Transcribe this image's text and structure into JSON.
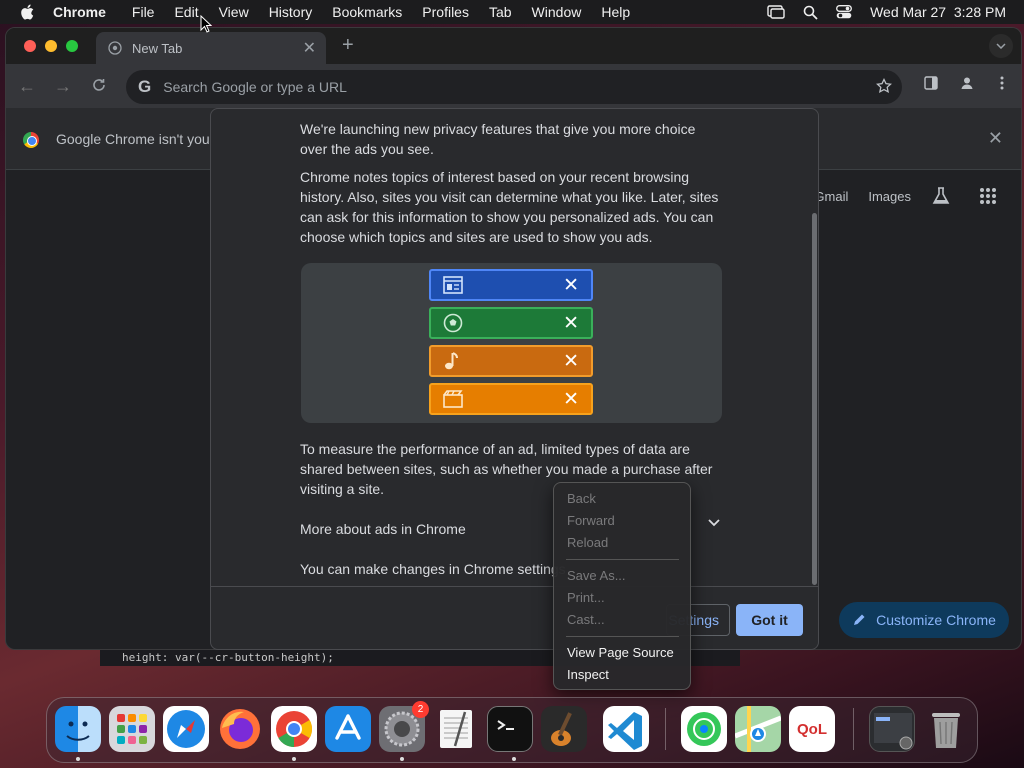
{
  "menubar": {
    "app_name": "Chrome",
    "items": [
      "File",
      "Edit",
      "View",
      "History",
      "Bookmarks",
      "Profiles",
      "Tab",
      "Window",
      "Help"
    ],
    "datetime": "Wed Mar 27  3:28 PM"
  },
  "browser": {
    "tab_title": "New Tab",
    "omnibox_placeholder": "Search Google or type a URL",
    "infobar_text": "Google Chrome isn't you",
    "ntp_links": [
      "Gmail",
      "Images"
    ],
    "customize_label": "Customize Chrome"
  },
  "dialog": {
    "para1": "We're launching new privacy features that give you more choice over the ads you see.",
    "para2": "Chrome notes topics of interest based on your recent browsing history. Also, sites you visit can determine what you like. Later, sites can ask for this information to show you personalized ads. You can choose which topics and sites are used to show you ads.",
    "para3": "To measure the performance of an ad, limited types of data are shared between sites, such as whether you made a purchase after visiting a site.",
    "expand_label": "More about ads in Chrome",
    "settings_text": "You can make changes in Chrome settings",
    "settings_button_label": "Settings",
    "gotit_label": "Got it",
    "topics": [
      {
        "icon": "newspaper-icon",
        "color": "#4f86f7",
        "bg": "#1e4fb0"
      },
      {
        "icon": "soccer-ball-icon",
        "color": "#3ab05a",
        "bg": "#1d7a38"
      },
      {
        "icon": "music-note-icon",
        "color": "#f29c2b",
        "bg": "#c96a10"
      },
      {
        "icon": "clapperboard-icon",
        "color": "#f7a21c",
        "bg": "#e67e00"
      }
    ]
  },
  "context_menu": {
    "back": "Back",
    "forward": "Forward",
    "reload": "Reload",
    "save_as": "Save As...",
    "print": "Print...",
    "cast": "Cast...",
    "view_source": "View Page Source",
    "inspect": "Inspect"
  },
  "code_peek": "height: var(--cr-button-height);",
  "dock": {
    "apps": [
      "finder-icon",
      "launchpad-icon",
      "safari-icon",
      "firefox-icon",
      "chrome-icon",
      "app-store-icon",
      "system-settings-icon",
      "textedit-icon",
      "terminal-icon",
      "garageband-icon",
      "vscode-icon",
      "find-my-icon",
      "maps-icon",
      "qol-app-icon",
      "screenshot-thumbnail-icon",
      "trash-icon"
    ],
    "settings_badge": "2",
    "qol_label": "QoL"
  }
}
